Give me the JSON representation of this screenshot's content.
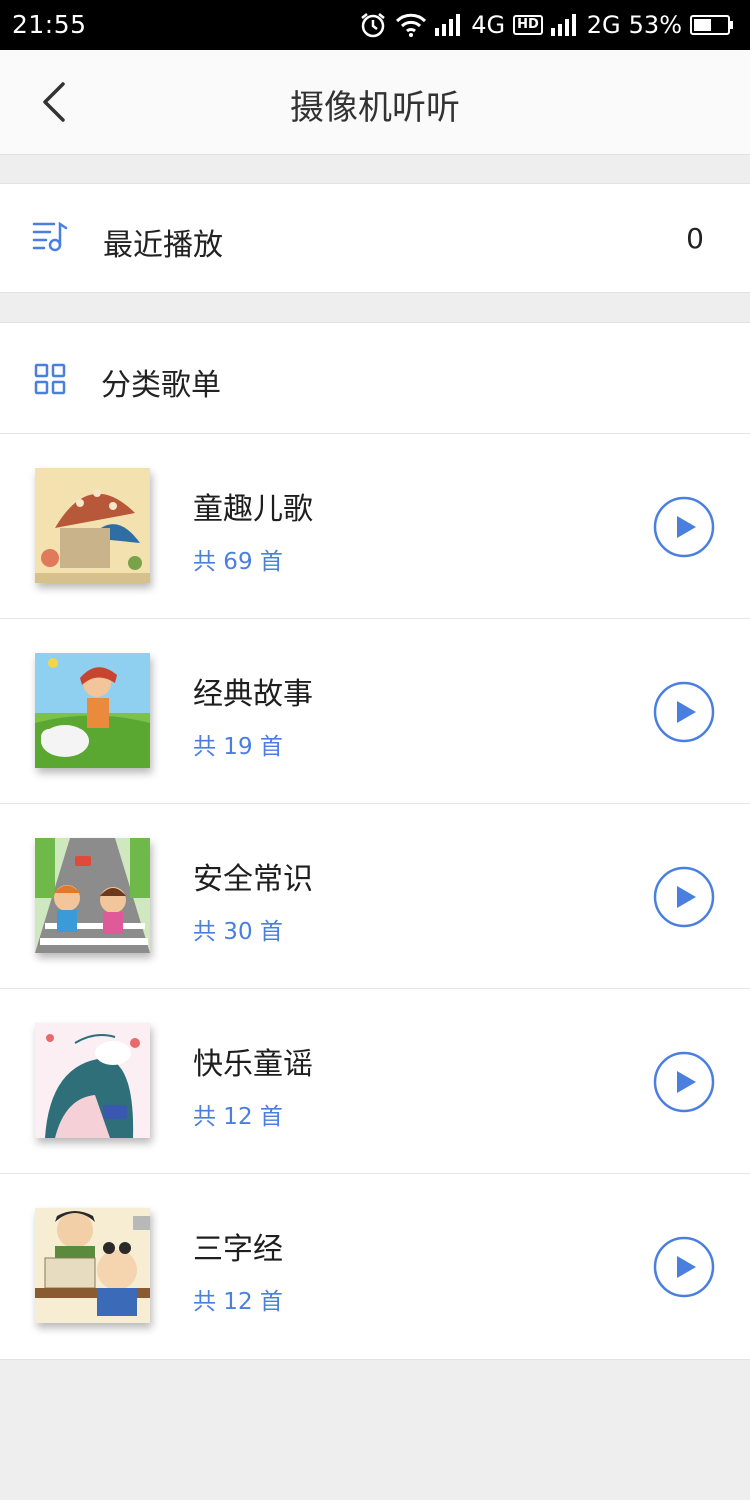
{
  "status_bar": {
    "time": "21:55",
    "network_4g": "4G",
    "hd_badge": "HD",
    "network_2g": "2G",
    "battery_percent": "53%",
    "battery_level": 0.53
  },
  "header": {
    "title": "摄像机听听",
    "back_icon": "chevron-left-icon"
  },
  "recent": {
    "icon": "music-list-icon",
    "label": "最近播放",
    "count": "0"
  },
  "category": {
    "icon": "grid-icon",
    "label": "分类歌单"
  },
  "playlists": [
    {
      "title": "童趣儿歌",
      "count": "共 69 首",
      "thumb": "mushroom-house-illustration"
    },
    {
      "title": "经典故事",
      "count": "共 19 首",
      "thumb": "child-with-sheep-illustration"
    },
    {
      "title": "安全常识",
      "count": "共 30 首",
      "thumb": "crosswalk-children-illustration"
    },
    {
      "title": "快乐童谣",
      "count": "共 12 首",
      "thumb": "girl-with-animal-illustration"
    },
    {
      "title": "三字经",
      "count": "共 12 首",
      "thumb": "teacher-and-student-illustration"
    }
  ],
  "colors": {
    "accent": "#4a7fe0",
    "background": "#eeeeee"
  }
}
